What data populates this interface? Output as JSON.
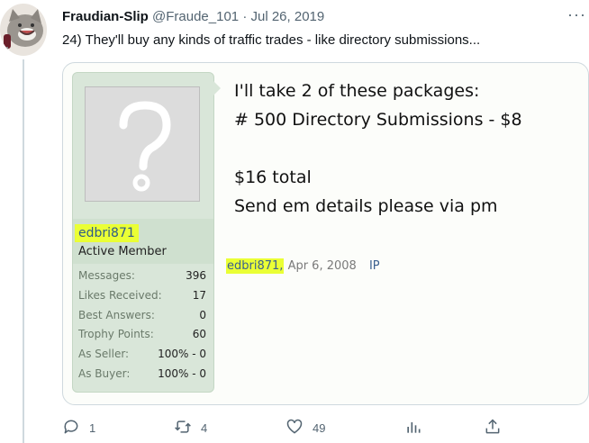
{
  "tweet": {
    "author_name": "Fraudian-Slip",
    "handle": "@Fraude_101",
    "separator": "·",
    "date": "Jul 26, 2019",
    "text": "24) They'll buy any kinds of traffic trades - like directory submissions...",
    "more_label": "···"
  },
  "post": {
    "username": "edbri871",
    "user_title": "Active Member",
    "stats": [
      {
        "label": "Messages:",
        "value": "396"
      },
      {
        "label": "Likes Received:",
        "value": "17"
      },
      {
        "label": "Best Answers:",
        "value": "0"
      },
      {
        "label": "Trophy Points:",
        "value": "60"
      },
      {
        "label": "As Seller:",
        "value": "100% - 0"
      },
      {
        "label": "As Buyer:",
        "value": "100% - 0"
      }
    ],
    "body_lines": [
      "I'll take 2 of these packages:",
      "# 500 Directory Submissions - $8",
      "$16 total",
      "Send em details please via pm"
    ],
    "meta_user": "edbri871",
    "meta_comma": ",",
    "meta_date": "Apr 6, 2008",
    "meta_ip": "IP"
  },
  "actions": {
    "reply_count": "1",
    "retweet_count": "4",
    "like_count": "49"
  },
  "colors": {
    "highlight": "#eaff35",
    "panel_green": "#d9e6d9",
    "link_blue": "#3a5f8f",
    "twitter_gray": "#536471"
  }
}
